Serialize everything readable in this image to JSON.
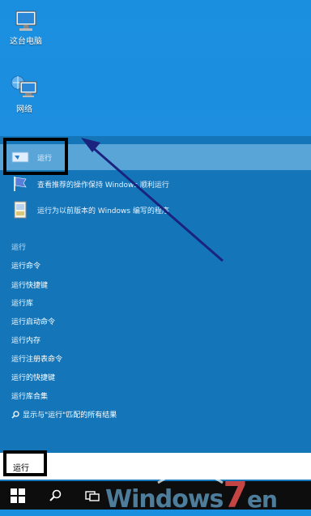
{
  "desktop": {
    "icons": [
      {
        "label": "这台电脑",
        "icon": "computer-icon"
      },
      {
        "label": "网络",
        "icon": "network-icon"
      }
    ]
  },
  "results": {
    "best_match": {
      "label": "运行",
      "icon": "run-icon"
    },
    "apps": [
      {
        "label": "查看推荐的操作保持 Windows 顺利运行",
        "icon": "action-center-flag-icon"
      },
      {
        "label": "运行为以前版本的 Windows 编写的程序",
        "icon": "compatibility-troubleshooter-icon"
      }
    ],
    "section_heading": "运行",
    "suggestions": [
      "运行命令",
      "运行快捷键",
      "运行库",
      "运行启动命令",
      "运行内存",
      "运行注册表命令",
      "运行的快捷键",
      "运行库合集"
    ],
    "search_all": "显示与\"运行\"匹配的所有结果"
  },
  "search": {
    "value": "运行"
  },
  "taskbar": {
    "items": [
      "windows-start-icon",
      "search-icon",
      "task-view-icon"
    ]
  },
  "watermark": {
    "text": "Windows7en"
  },
  "colors": {
    "desktop": "#1a8fe0",
    "panel": "#1476b9",
    "selection": "#5aa5d8",
    "annotation_arrow": "#1a237e"
  }
}
